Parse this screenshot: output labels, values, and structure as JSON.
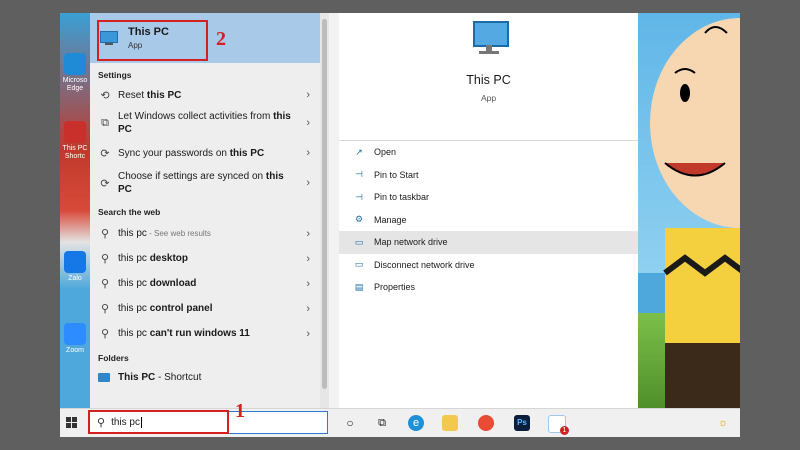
{
  "desktop": {
    "icons": [
      {
        "label": "Microso Edge"
      },
      {
        "label": "This PC Shortc"
      },
      {
        "label": "Zalo"
      },
      {
        "label": "Zoom"
      }
    ]
  },
  "best_match": {
    "title": "This PC",
    "subtitle": "App"
  },
  "sections": {
    "settings": "Settings",
    "web": "Search the web",
    "folders": "Folders"
  },
  "settings_items": [
    {
      "pre": "Reset ",
      "bold": "this PC",
      "post": ""
    },
    {
      "pre": "Let Windows collect activities from ",
      "bold": "this PC",
      "post": ""
    },
    {
      "pre": "Sync your passwords on ",
      "bold": "this PC",
      "post": ""
    },
    {
      "pre": "Choose if settings are synced on ",
      "bold": "this PC",
      "post": ""
    }
  ],
  "web_items": [
    {
      "pre": "this pc",
      "bold": "",
      "hint": " - See web results"
    },
    {
      "pre": "this pc ",
      "bold": "desktop",
      "hint": ""
    },
    {
      "pre": "this pc ",
      "bold": "download",
      "hint": ""
    },
    {
      "pre": "this pc ",
      "bold": "control panel",
      "hint": ""
    },
    {
      "pre": "this pc ",
      "bold": "can't run windows 11",
      "hint": ""
    }
  ],
  "folder_items": [
    {
      "bold": "This PC",
      "post": " - Shortcut"
    }
  ],
  "detail": {
    "title": "This PC",
    "subtitle": "App",
    "actions": [
      {
        "label": "Open",
        "icon": "open-icon"
      },
      {
        "label": "Pin to Start",
        "icon": "pin-icon"
      },
      {
        "label": "Pin to taskbar",
        "icon": "pin-icon"
      },
      {
        "label": "Manage",
        "icon": "manage-icon"
      },
      {
        "label": "Map network drive",
        "icon": "network-drive-icon"
      },
      {
        "label": "Disconnect network drive",
        "icon": "disconnect-drive-icon"
      },
      {
        "label": "Properties",
        "icon": "properties-icon"
      }
    ]
  },
  "taskbar": {
    "search_value": "this pc",
    "badge_count": "1"
  },
  "annotations": {
    "step1": "1",
    "step2": "2"
  },
  "colors": {
    "highlight": "#a9c9e8",
    "annotation": "#d42020",
    "accent": "#2a7ad4"
  }
}
